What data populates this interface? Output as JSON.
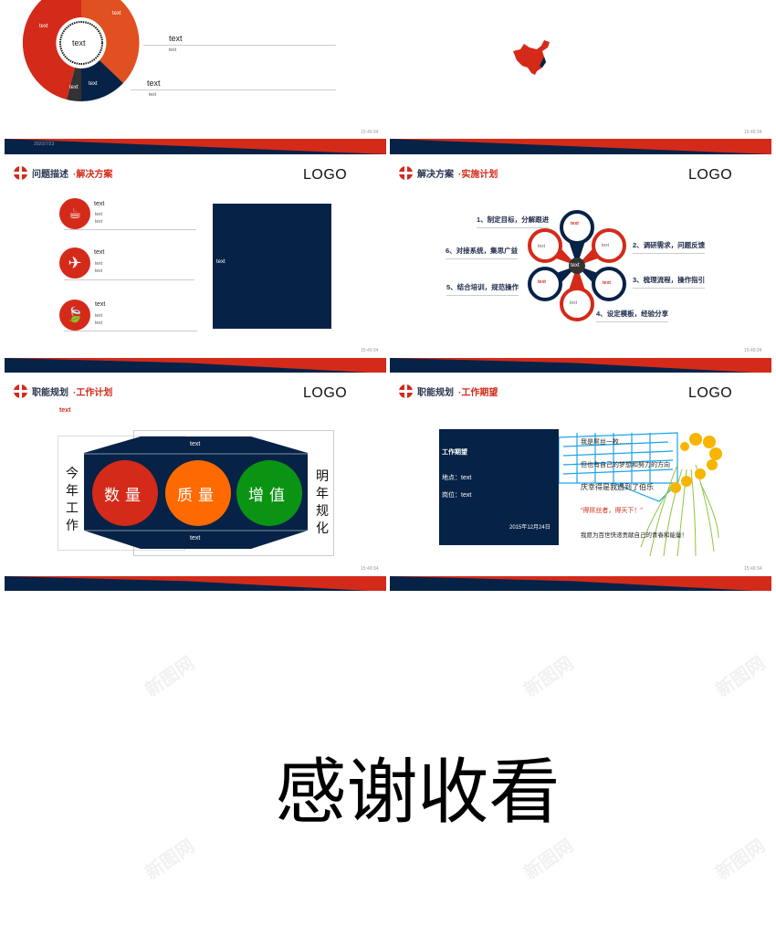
{
  "colors": {
    "navy": "#062246",
    "red": "#d42a1a",
    "orange": "#e05020",
    "orange_bright": "#ff6a00",
    "green": "#0b9414",
    "grey": "#333333"
  },
  "watermark": "新图网",
  "slide1": {
    "top_cut_text": "text",
    "donut_center": "text",
    "segments": [
      {
        "label": "text",
        "color": "#e05020"
      },
      {
        "label": "text",
        "color": "#062246"
      },
      {
        "label": "text",
        "color": "#333333"
      },
      {
        "label": "text",
        "color": "#d42a1a"
      }
    ],
    "items": [
      {
        "title": "text",
        "sub": "text"
      },
      {
        "title": "text",
        "sub": "text"
      }
    ],
    "date": "2020/7/23",
    "time": "15:49:34"
  },
  "slide2": {
    "time": "15:49:34",
    "map_icon": "china-map"
  },
  "slide3": {
    "title_main": "问题描述",
    "title_sub": "·解决方案",
    "logo": "LOGO",
    "items": [
      {
        "icon": "coffee-cup-icon",
        "title": "text",
        "lines": [
          "text",
          "text"
        ]
      },
      {
        "icon": "airplane-icon",
        "title": "text",
        "lines": [
          "text",
          "text"
        ]
      },
      {
        "icon": "leaf-icon",
        "title": "text",
        "lines": [
          "text",
          "text"
        ]
      }
    ],
    "box_text": "text",
    "time": "15:49:34"
  },
  "slide4": {
    "title_main": "解决方案",
    "title_sub": "·实施计划",
    "logo": "LOGO",
    "center": "text",
    "petals": [
      "text",
      "text",
      "text",
      "text",
      "text",
      "text"
    ],
    "steps": [
      "1、制定目标，分解跟进",
      "2、调研需求，问题反馈",
      "3、梳理流程，操作指引",
      "4、设定模板，经验分享",
      "5、结合培训，规范操作",
      "6、对接系统，集思广益"
    ],
    "time": "15:49:34"
  },
  "slide5": {
    "title_main": "职能规划",
    "title_sub": "·工作计划",
    "logo": "LOGO",
    "subtitle": "text",
    "top_text": "text",
    "bottom_text": "text",
    "left_label": "今年工作",
    "right_label": "明年规化",
    "circles": [
      {
        "label": "数量",
        "color": "#d42a1a"
      },
      {
        "label": "质量",
        "color": "#ff6a00"
      },
      {
        "label": "增值",
        "color": "#0b9414"
      }
    ],
    "time": "15:49:34"
  },
  "slide6": {
    "title_main": "职能规划",
    "title_sub": "·工作期望",
    "logo": "LOGO",
    "box_title": "工作期望",
    "location": "地点：text",
    "position": "岗位：text",
    "date": "2015年12月24日",
    "lines": [
      "我是屌丝一枚……",
      "但也有自己的梦想和努力的方向",
      "庆幸得是我遇到了伯乐",
      "“得屌丝者，得天下！”",
      "我愿为百世快递贡献自己的青春和能量！"
    ],
    "time": "15:49:34"
  },
  "closing": "感谢收看"
}
